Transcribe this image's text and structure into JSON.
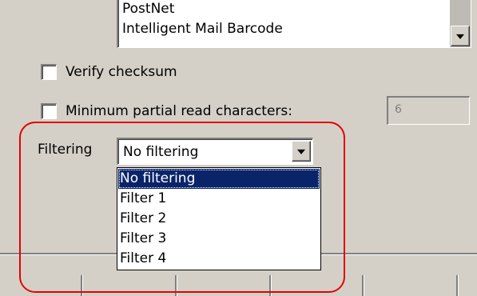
{
  "barcode_list": {
    "items": [
      "PostNet",
      "Intelligent Mail Barcode"
    ]
  },
  "options": {
    "verify_checksum": {
      "label": "Verify checksum",
      "checked": false
    },
    "min_partial_read": {
      "label": "Minimum partial read characters:",
      "checked": false,
      "value": "6"
    }
  },
  "filtering": {
    "label": "Filtering",
    "selected": "No filtering",
    "dropdown_items": [
      "No filtering",
      "Filter 1",
      "Filter 2",
      "Filter 3",
      "Filter 4"
    ],
    "highlighted_index": 0
  },
  "colors": {
    "dialog_bg": "#d4d0c8",
    "selection_bg": "#0a246a",
    "annotation": "#e60000"
  },
  "icons": {
    "listbox_scroll": "chevron-down-icon",
    "combo_toggle": "chevron-down-icon"
  }
}
